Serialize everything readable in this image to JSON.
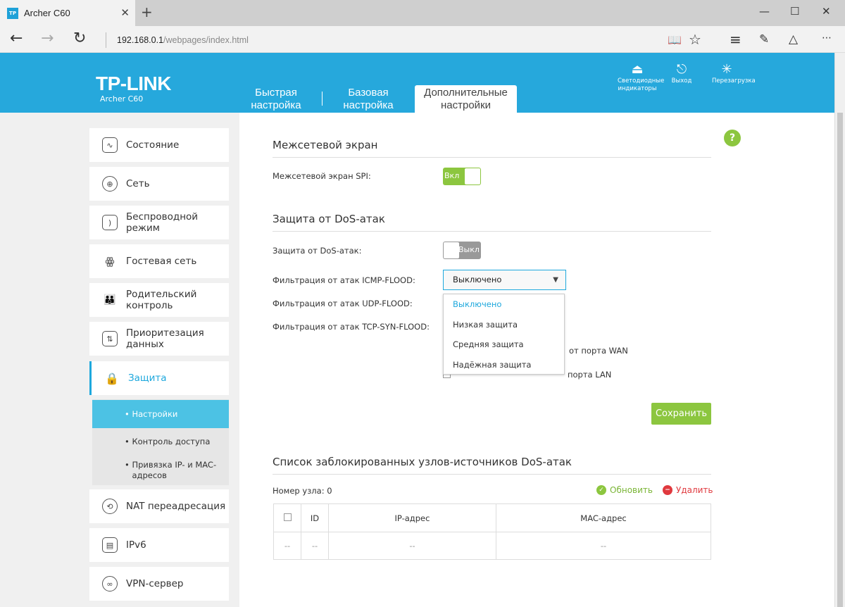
{
  "browser": {
    "tab_title": "Archer C60",
    "favicon_text": "TP",
    "url_host": "192.168.0.1",
    "url_path": "/webpages/index.html"
  },
  "header": {
    "logo": "TP-LINK",
    "model": "Archer C60",
    "tabs": [
      {
        "label": "Быстрая настройка"
      },
      {
        "label": "Базовая настройка"
      },
      {
        "label": "Дополнительные настройки"
      }
    ],
    "icons": [
      {
        "label": "Светодиодные индикаторы",
        "icon": "led-icon"
      },
      {
        "label": "Выход",
        "icon": "logout-icon"
      },
      {
        "label": "Перезагрузка",
        "icon": "reboot-icon"
      }
    ]
  },
  "sidebar": {
    "items": [
      {
        "label": "Состояние",
        "icon": "status-icon"
      },
      {
        "label": "Сеть",
        "icon": "globe-icon"
      },
      {
        "label": "Беспроводной режим",
        "icon": "wireless-icon"
      },
      {
        "label": "Гостевая сеть",
        "icon": "guest-icon"
      },
      {
        "label": "Родительский контроль",
        "icon": "parental-icon"
      },
      {
        "label": "Приоритезация данных",
        "icon": "qos-icon"
      },
      {
        "label": "Защита",
        "icon": "lock-icon"
      },
      {
        "label": "NAT переадресация",
        "icon": "nat-icon"
      },
      {
        "label": "IPv6",
        "icon": "ipv6-icon"
      },
      {
        "label": "VPN-сервер",
        "icon": "vpn-icon"
      }
    ],
    "subitems": [
      {
        "label": "Настройки"
      },
      {
        "label": "Контроль доступа"
      },
      {
        "label": "Привязка IP- и MAC-адресов"
      }
    ]
  },
  "firewall": {
    "title": "Межсетевой экран",
    "spi_label": "Межсетевой экран SPI:",
    "spi_state": "Вкл"
  },
  "dos": {
    "title": "Защита от DoS-атак",
    "dos_label": "Защита от DoS-атак:",
    "dos_state": "Выкл",
    "icmp_label": "Фильтрация от атак ICMP-FLOOD:",
    "icmp_value": "Выключено",
    "udp_label": "Фильтрация от атак UDP-FLOOD:",
    "tcp_label": "Фильтрация от атак TCP-SYN-FLOOD:",
    "options": [
      "Выключено",
      "Низкая защита",
      "Средняя защита",
      "Надёжная защита"
    ],
    "wan_ping_fragment": "от порта WAN",
    "lan_ping_fragment": "порта LAN",
    "save": "Сохранить"
  },
  "blocked": {
    "title": "Список заблокированных узлов-источников DoS-атак",
    "count_label": "Номер узла:",
    "count": "0",
    "refresh": "Обновить",
    "delete": "Удалить",
    "columns": [
      "ID",
      "IP-адрес",
      "MAC-адрес"
    ],
    "row": [
      "--",
      "--",
      "--",
      "--"
    ]
  },
  "colors": {
    "brand": "#26a8dc",
    "accent_green": "#8cc63f",
    "delete_red": "#e0393e"
  }
}
